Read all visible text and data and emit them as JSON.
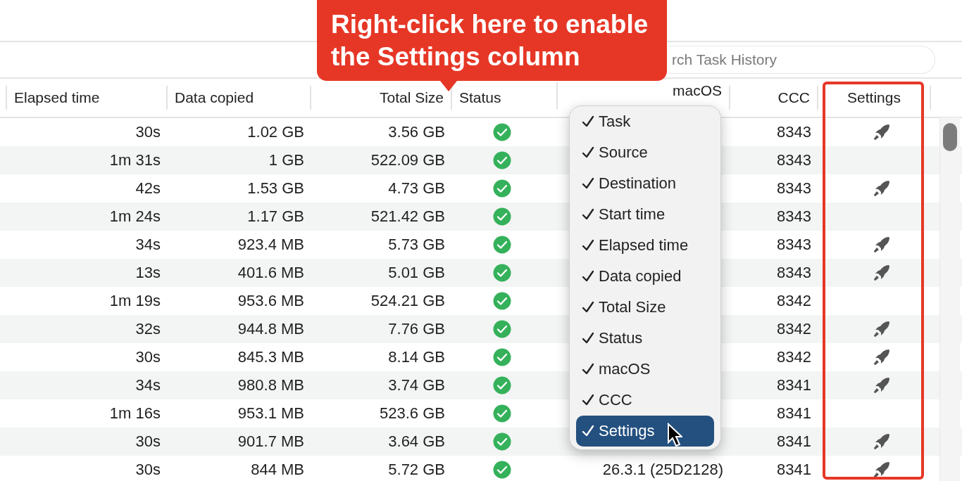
{
  "callout": {
    "text": "Right-click here to enable the Settings column"
  },
  "search": {
    "placeholder": "rch Task History"
  },
  "table": {
    "columns": [
      {
        "label": "Elapsed time"
      },
      {
        "label": "Data copied"
      },
      {
        "label": "Total Size"
      },
      {
        "label": "Status"
      },
      {
        "label": "macOS"
      },
      {
        "label": "CCC"
      },
      {
        "label": "Settings"
      }
    ],
    "rows": [
      {
        "elapsed": "30s",
        "copied": "1.02 GB",
        "total": "3.56 GB",
        "ccc": "8343",
        "settings": true
      },
      {
        "elapsed": "1m 31s",
        "copied": "1 GB",
        "total": "522.09 GB",
        "ccc": "8343",
        "settings": false
      },
      {
        "elapsed": "42s",
        "copied": "1.53 GB",
        "total": "4.73 GB",
        "ccc": "8343",
        "settings": true
      },
      {
        "elapsed": "1m 24s",
        "copied": "1.17 GB",
        "total": "521.42 GB",
        "ccc": "8343",
        "settings": false
      },
      {
        "elapsed": "34s",
        "copied": "923.4 MB",
        "total": "5.73 GB",
        "ccc": "8343",
        "settings": true
      },
      {
        "elapsed": "13s",
        "copied": "401.6 MB",
        "total": "5.01 GB",
        "ccc": "8343",
        "settings": true
      },
      {
        "elapsed": "1m 19s",
        "copied": "953.6 MB",
        "total": "524.21 GB",
        "ccc": "8342",
        "settings": false
      },
      {
        "elapsed": "32s",
        "copied": "944.8 MB",
        "total": "7.76 GB",
        "ccc": "8342",
        "settings": true
      },
      {
        "elapsed": "30s",
        "copied": "845.3 MB",
        "total": "8.14 GB",
        "ccc": "8342",
        "settings": true
      },
      {
        "elapsed": "34s",
        "copied": "980.8 MB",
        "total": "3.74 GB",
        "ccc": "8341",
        "settings": true
      },
      {
        "elapsed": "1m 16s",
        "copied": "953.1 MB",
        "total": "523.6 GB",
        "ccc": "8341",
        "settings": false
      },
      {
        "elapsed": "30s",
        "copied": "901.7 MB",
        "total": "3.64 GB",
        "ccc": "8341",
        "settings": true
      },
      {
        "elapsed": "30s",
        "copied": "844 MB",
        "total": "5.72 GB",
        "macos": "26.3.1 (25D2128)",
        "ccc": "8341",
        "settings": true
      }
    ]
  },
  "context_menu": {
    "items": [
      {
        "label": "Task",
        "checked": true,
        "selected": false
      },
      {
        "label": "Source",
        "checked": true,
        "selected": false
      },
      {
        "label": "Destination",
        "checked": true,
        "selected": false
      },
      {
        "label": "Start time",
        "checked": true,
        "selected": false
      },
      {
        "label": "Elapsed time",
        "checked": true,
        "selected": false
      },
      {
        "label": "Data copied",
        "checked": true,
        "selected": false
      },
      {
        "label": "Total Size",
        "checked": true,
        "selected": false
      },
      {
        "label": "Status",
        "checked": true,
        "selected": false
      },
      {
        "label": "macOS",
        "checked": true,
        "selected": false
      },
      {
        "label": "CCC",
        "checked": true,
        "selected": false
      },
      {
        "label": "Settings",
        "checked": true,
        "selected": true
      }
    ]
  }
}
